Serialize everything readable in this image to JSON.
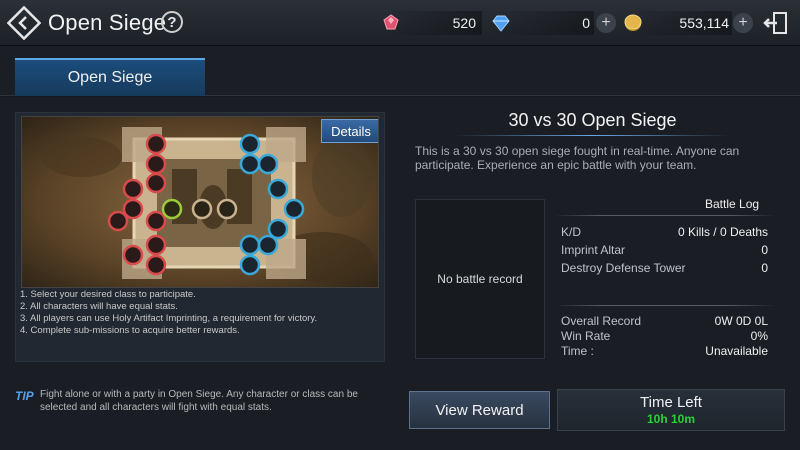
{
  "header": {
    "title": "Open Siege",
    "help": "?",
    "currencies": [
      {
        "icon": "red-gem-icon",
        "value": "520",
        "color": "#e0526e"
      },
      {
        "icon": "blue-diamond-icon",
        "value": "0",
        "color": "#4fa0f0"
      },
      {
        "icon": "gold-coin-icon",
        "value": "553,114",
        "color": "#d9a93a"
      }
    ],
    "plus": "+"
  },
  "tabs": [
    {
      "label": "Open Siege",
      "active": true
    }
  ],
  "map": {
    "details_label": "Details",
    "rules": [
      "1. Select your desired class to participate.",
      "2. All characters will have equal stats.",
      "3. All players can use Holy Artifact Imprinting, a requirement for victory.",
      "4. Complete sub-missions to acquire better rewards."
    ]
  },
  "tip": {
    "label": "TIP",
    "text": "Fight alone or with a party in Open Siege. Any character or class can be selected and all characters will fight with equal stats."
  },
  "siege": {
    "title": "30 vs 30 Open Siege",
    "description": "This is a 30 vs 30 open siege fought in real-time. Anyone can participate. Experience an epic battle with your team."
  },
  "record": {
    "empty_text": "No battle record",
    "log_title": "Battle Log",
    "stats": [
      {
        "label": "K/D",
        "value": "0 Kills / 0 Deaths"
      },
      {
        "label": "Imprint Altar",
        "value": "0"
      },
      {
        "label": "Destroy Defense Tower",
        "value": "0"
      }
    ],
    "overall": [
      {
        "label": "Overall Record",
        "value": "0W 0D 0L"
      },
      {
        "label": "Win Rate",
        "value": "0%"
      },
      {
        "label": "Time :",
        "value": "Unavailable"
      }
    ]
  },
  "actions": {
    "view_reward": "View Reward",
    "time_left_label": "Time Left",
    "time_left_value": "10h 10m"
  },
  "colors": {
    "red_team": "#d94b4b",
    "blue_team": "#3aa8d8",
    "neutral": "#9acc3c",
    "accent": "#5aa7e8"
  }
}
